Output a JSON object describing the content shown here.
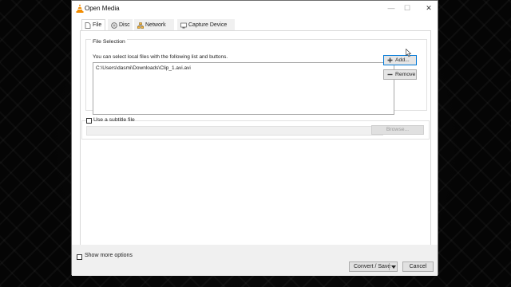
{
  "window": {
    "title": "Open Media",
    "icon": "vlc-cone-icon"
  },
  "tabs": [
    {
      "label": "File",
      "icon": "file-icon",
      "active": true
    },
    {
      "label": "Disc",
      "icon": "disc-icon",
      "active": false
    },
    {
      "label": "Network",
      "icon": "network-icon",
      "active": false
    },
    {
      "label": "Capture Device",
      "icon": "capture-device-icon",
      "active": false
    }
  ],
  "file_selection": {
    "title": "File Selection",
    "hint": "You can select local files with the following list and buttons.",
    "files": [
      "C:\\Users\\dasmi\\Downloads\\Clip_1.avi.avi"
    ],
    "add_label": "Add...",
    "remove_label": "Remove"
  },
  "subtitle": {
    "checkbox_label": "Use a subtitle file",
    "checked": false,
    "path_value": "",
    "browse_label": "Browse..."
  },
  "footer": {
    "show_more_label": "Show more options",
    "show_more_checked": false,
    "convert_label": "Convert / Save",
    "cancel_label": "Cancel"
  },
  "colors": {
    "accent_border": "#0078d7",
    "vlc_orange": "#f28c00"
  }
}
